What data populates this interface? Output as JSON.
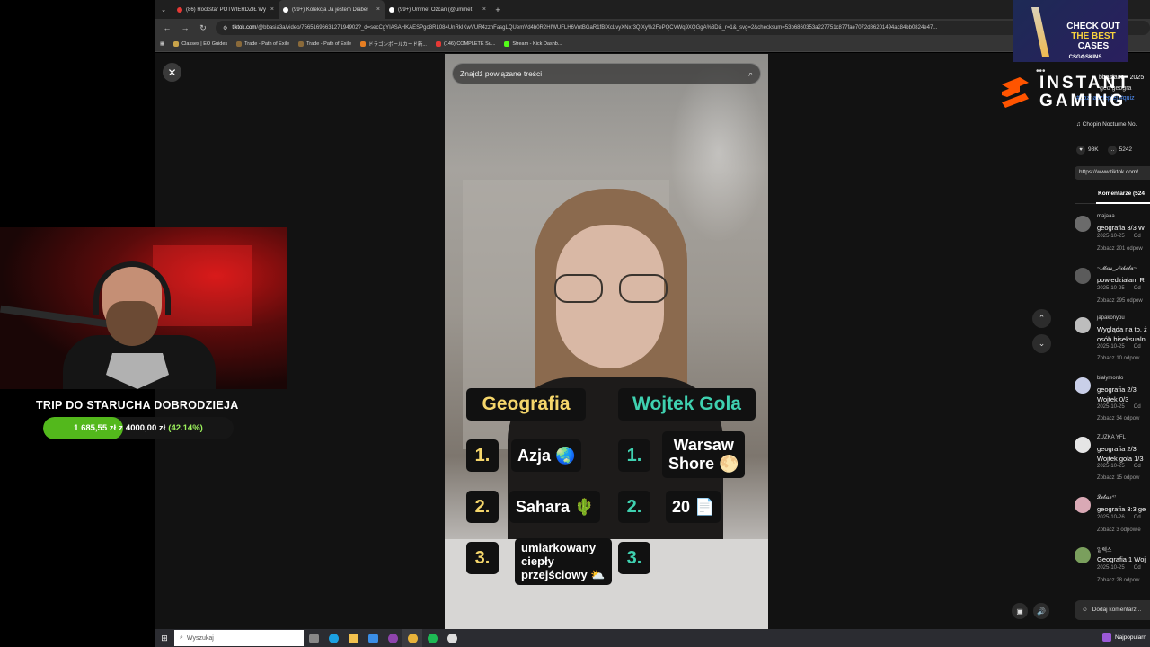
{
  "browser": {
    "tabs": [
      {
        "label": "(86) Rockstar POTWIERDZIŁ Wy",
        "color": "#e53935"
      },
      {
        "label": "(99+) Kolekcja Ja jestem Diabeł",
        "color": "#fff"
      },
      {
        "label": "(99+) Ummet Ozcan (@ummet",
        "color": "#fff"
      }
    ],
    "tab_close": "×",
    "new_tab": "+",
    "url_host": "tiktok.com",
    "url_path": "/@bbasia3a/video/7565169663127194902?_d=secCgYIASAHKAESPgo8RL084UnRkIKwVUR4zzhFasgLQUemVd4b0R2HIWUFLH6VntBGaR1fBIXcLvyXNxr3QlXy%2FePQCVWq9XQGgA%3D&_r=1&_svg=2&checksum=53b6860353a227751c877fae7072d86201494ac84bb0824e47...",
    "bookmarks": [
      "Classes | EO Guides",
      "Trade - Path of Exile",
      "Trade - Path of Exile",
      "ドラゴンボールカード新...",
      "(146) COMPLETE Su...",
      "Stream - Kick Dashb..."
    ]
  },
  "tiktok": {
    "close_icon": "✕",
    "search_placeholder": "Znajdź powiązane treści",
    "quiz": {
      "left_header": "Geografia",
      "right_header": "Wojtek Gola",
      "rows": [
        {
          "num": "1.",
          "left": "Azja 🌏",
          "right_num": "1.",
          "right_l1": "Warsaw",
          "right_l2": "Shore 🌕"
        },
        {
          "num": "2.",
          "left": "Sahara 🌵",
          "right_num": "2.",
          "right": "20 📄"
        },
        {
          "num": "3.",
          "left_l1": "umiarkowany",
          "left_l2": "ciepły",
          "left_l3": "przejściowy ⛅",
          "right_num": "3."
        }
      ]
    },
    "panel": {
      "author": "bbasia3a",
      "desc_date": "· 2025",
      "desc_line": "geo geogra",
      "tags": "#coznaszlepiej #quiz",
      "music": "♫ Chopin Nocturne No.",
      "likes": "98K",
      "comments_count": "5242",
      "link": "https://www.tiktok.com/",
      "comments_tab": "Komentarze (524",
      "comments": [
        {
          "user": "majaaa",
          "text": "geografia 3/3 W",
          "date": "2025-10-25",
          "reply": "Od",
          "replies": "Zobacz 201 odpow",
          "avatar": "#6b6b6b"
        },
        {
          "user": "~𝓜𝓲𝓼𝓼_𝓝𝓲𝓴𝓸𝓵𝓪~",
          "text": "powiedziałam R",
          "date": "2025-10-25",
          "reply": "Od",
          "replies": "Zobacz 295 odpow",
          "avatar": "#5b5b5b"
        },
        {
          "user": "japakonyou",
          "text": "Wygląda na to, ż",
          "text2": "osób biseksualn",
          "date": "2025-10-25",
          "reply": "Od",
          "replies": "Zobacz 10 odpow",
          "avatar": "#bdbdbd"
        },
        {
          "user": "białymordo",
          "text": "geografia 2/3",
          "text2": "Wojtek 0/3",
          "date": "2025-10-25",
          "reply": "Od",
          "replies": "Zobacz 34 odpow",
          "avatar": "#c9cfe8"
        },
        {
          "user": "ZUZKA YFL",
          "text": "geografia 2/3",
          "text2": "Wojtek gola 1/3",
          "date": "2025-10-25",
          "reply": "Od",
          "replies": "Zobacz 15 odpow",
          "avatar": "#e5e5e5"
        },
        {
          "user": "𝓛𝓮𝓽𝓲𝓼𝓮⁴⁷",
          "text": "geografia 3:3 ge",
          "date": "2025-10-26",
          "reply": "Od",
          "replies": "Zobacz 3 odpowie",
          "avatar": "#d9a9b5"
        },
        {
          "user": "알렉스",
          "text": "Geografia 1 Woj",
          "date": "2025-10-25",
          "reply": "Od",
          "replies": "Zobacz 28 odpow",
          "avatar": "#7a9f5d"
        }
      ],
      "add_comment": "Dodaj komentarz..."
    }
  },
  "ads": {
    "csgo_l1": "CHECK OUT",
    "csgo_l2": "THE BEST",
    "csgo_l3": "CASES",
    "csgo_brand": "CSG⚙SKINS",
    "ig_l1": "INSTANT",
    "ig_l2": "GAMING"
  },
  "goal": {
    "title": "TRIP DO STARUCHA DOBRODZIEJA",
    "current": "1 685,55 zł",
    "sep": "z",
    "target": "4000,00 zł",
    "percent_label": "(42.14%)",
    "progress": 0.4214
  },
  "taskbar": {
    "search_placeholder": "Wyszukaj",
    "tray_label": "Najpopularn"
  }
}
